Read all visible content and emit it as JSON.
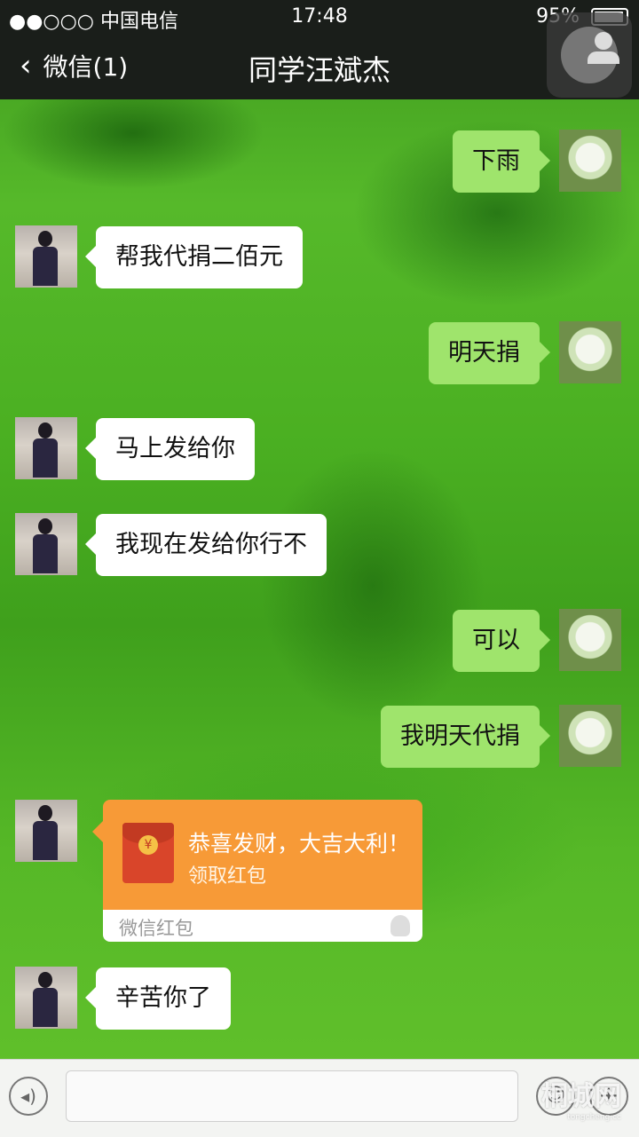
{
  "status_bar": {
    "carrier": "●●○○○ 中国电信",
    "wifi_icon": "wifi-icon",
    "time": "17:48",
    "battery": "95%"
  },
  "nav": {
    "back_label": "微信(1)",
    "title": "同学汪斌杰"
  },
  "messages": [
    {
      "side": "out",
      "text": "下雨"
    },
    {
      "side": "in",
      "text": "帮我代捐二佰元"
    },
    {
      "side": "out",
      "text": "明天捐"
    },
    {
      "side": "in",
      "text": "马上发给你"
    },
    {
      "side": "in",
      "text": "我现在发给你行不"
    },
    {
      "side": "out",
      "text": "可以"
    },
    {
      "side": "out",
      "text": "我明天代捐"
    },
    {
      "side": "in",
      "type": "red_packet"
    },
    {
      "side": "in",
      "text": "辛苦你了"
    }
  ],
  "red_packet": {
    "coin_symbol": "¥",
    "greeting": "恭喜发财，大吉大利！",
    "action": "领取红包",
    "brand": "微信红包"
  },
  "watermark": {
    "text": "桐城网",
    "sub": "tongcheng.cc"
  },
  "colors": {
    "outgoing_bubble": "#9fe46c",
    "incoming_bubble": "#ffffff",
    "red_packet": "#f79a37",
    "nav_bar": "#1a1e1a"
  }
}
